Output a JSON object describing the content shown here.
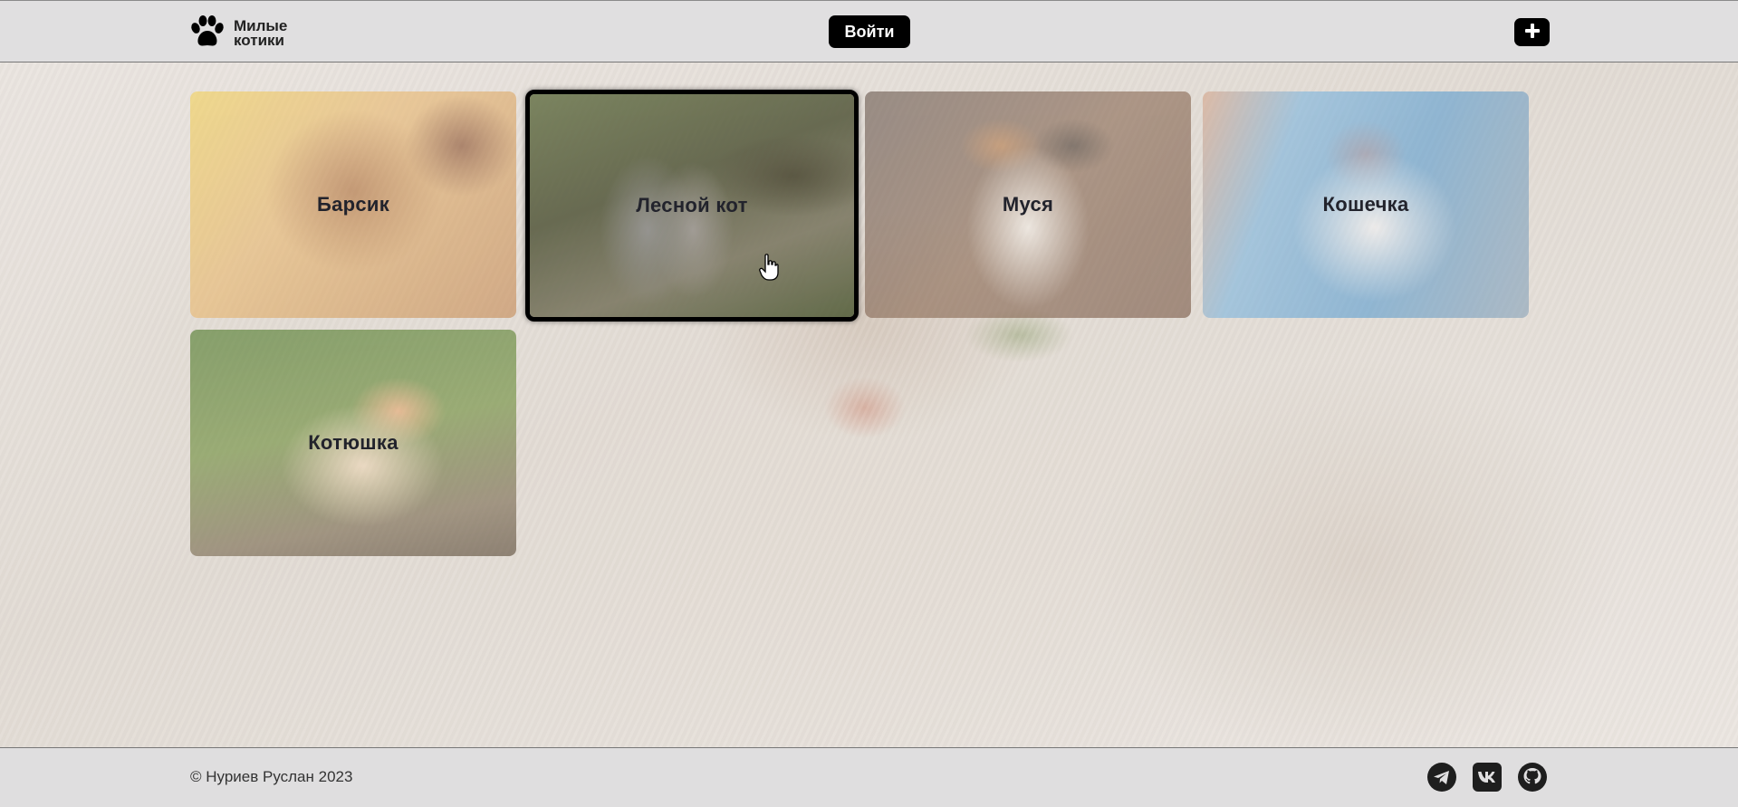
{
  "header": {
    "logo_line1": "Милые",
    "logo_line2": "котики",
    "login_label": "Войти",
    "logo_icon": "paw-icon",
    "add_icon": "plus-icon"
  },
  "cats": [
    {
      "name": "Барсик"
    },
    {
      "name": "Лесной кот"
    },
    {
      "name": "Муся"
    },
    {
      "name": "Кошечка"
    },
    {
      "name": "Котюшка"
    }
  ],
  "footer": {
    "copyright": "© Нуриев Руслан 2023",
    "social_icons": [
      "telegram-icon",
      "vk-icon",
      "github-icon"
    ]
  },
  "colors": {
    "header_bg": "#e0dfe0",
    "button_bg": "#000000",
    "card_text": "#22232c"
  }
}
